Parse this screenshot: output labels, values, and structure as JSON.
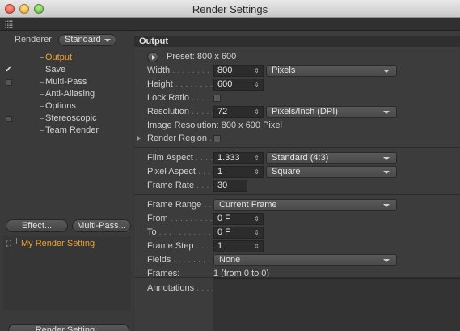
{
  "window": {
    "title": "Render Settings"
  },
  "sidebar": {
    "renderer_label": "Renderer",
    "renderer_value": "Standard",
    "items": [
      {
        "label": "Output",
        "checked": false,
        "selected": true
      },
      {
        "label": "Save",
        "checked": true,
        "selected": false
      },
      {
        "label": "Multi-Pass",
        "checked": false,
        "selected": false
      },
      {
        "label": "Anti-Aliasing",
        "checked": false,
        "selected": false
      },
      {
        "label": "Options",
        "checked": false,
        "selected": false
      },
      {
        "label": "Stereoscopic",
        "checked": false,
        "selected": false
      },
      {
        "label": "Team Render",
        "checked": false,
        "selected": false
      }
    ],
    "effect_button": "Effect...",
    "multipass_button": "Multi-Pass...",
    "setting_name": "My Render Setting",
    "render_setting_button": "Render Setting..."
  },
  "output": {
    "section_title": "Output",
    "preset": "Preset: 800 x 600",
    "width_label": "Width",
    "width_value": "800",
    "width_unit": "Pixels",
    "height_label": "Height",
    "height_value": "600",
    "lock_ratio_label": "Lock Ratio",
    "resolution_label": "Resolution",
    "resolution_value": "72",
    "resolution_unit": "Pixels/Inch (DPI)",
    "image_resolution": "Image Resolution: 800 x 600 Pixel",
    "render_region_label": "Render Region",
    "film_aspect_label": "Film Aspect",
    "film_aspect_value": "1.333",
    "film_aspect_preset": "Standard (4:3)",
    "pixel_aspect_label": "Pixel Aspect",
    "pixel_aspect_value": "1",
    "pixel_aspect_preset": "Square",
    "frame_rate_label": "Frame Rate",
    "frame_rate_value": "30",
    "frame_range_label": "Frame Range",
    "frame_range_value": "Current Frame",
    "from_label": "From",
    "from_value": "0 F",
    "to_label": "To",
    "to_value": "0 F",
    "frame_step_label": "Frame Step",
    "frame_step_value": "1",
    "fields_label": "Fields",
    "fields_value": "None",
    "frames_label": "Frames:",
    "frames_value": "1 (from 0 to 0)",
    "annotations_label": "Annotations"
  },
  "spin_glyph": "⇕",
  "check_glyph": "✔",
  "dots": {
    "width": " . . . . . . . . . .",
    "height": " . . . . . . . . . .",
    "lock": " . . . . . .",
    "resolution": " . . . . . . .",
    "region": " . . .",
    "film": " . . . . . .",
    "pixel": " . . . . .",
    "rate": " . . . . . . .",
    "range": " . . . .",
    "from": " . . . . . . . . . . . .",
    "to": " . . . . . . . . . . . . . .",
    "step": " . . . . . .",
    "fields": " . . . . . . . . . .",
    "annotations": " . . . . ."
  }
}
